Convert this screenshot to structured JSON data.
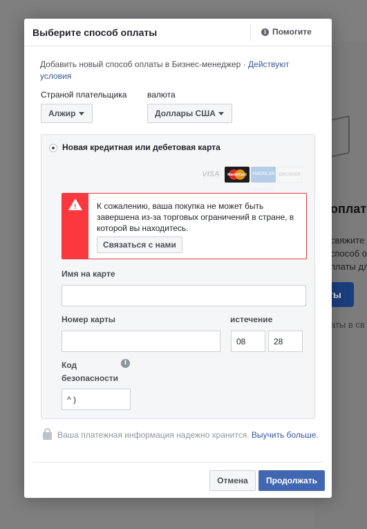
{
  "background": {
    "title_fragment": "оплаты",
    "lines": [
      "свяжите",
      "способ оп",
      "платы дл"
    ],
    "button_fragment": "ты",
    "footer_fragment": "аты в св"
  },
  "dialog": {
    "title": "Выберите способ оплаты",
    "help_label": "Помогите",
    "intro_text": "Добавить новый способ оплаты в Бизнес-менеджер · ",
    "intro_link": "Действуют условия",
    "country_label": "Страной плательщика",
    "country_value": "Алжир",
    "currency_label": "валюта",
    "currency_value": "Доллары США",
    "payment_option_label": "Новая кредитная или дебетовая карта",
    "card_brands": [
      "VISA",
      "MasterCard",
      "AMERICAN EXPRESS",
      "DISCOVER"
    ],
    "alert": {
      "text": "К сожалению, ваша покупка не может быть завершена из-за торговых ограничений в стране, в которой вы находитесь.",
      "button_label": "Связаться с нами"
    },
    "fields": {
      "name_label": "Имя на карте",
      "name_value": "",
      "card_number_label": "Номер карты",
      "card_number_value": "",
      "expiry_label": "истечение",
      "expiry_month": "08",
      "expiry_year": "28",
      "security_label": "Код безопасности",
      "security_value": "^ )"
    },
    "secure_text": "Ваша платежная информация надежно хранится. ",
    "secure_link": "Выучить больше.",
    "cancel_label": "Отмена",
    "continue_label": "Продолжать",
    "colors": {
      "primary": "#4267b2",
      "link": "#365899",
      "alert_red": "#fa383e"
    }
  }
}
